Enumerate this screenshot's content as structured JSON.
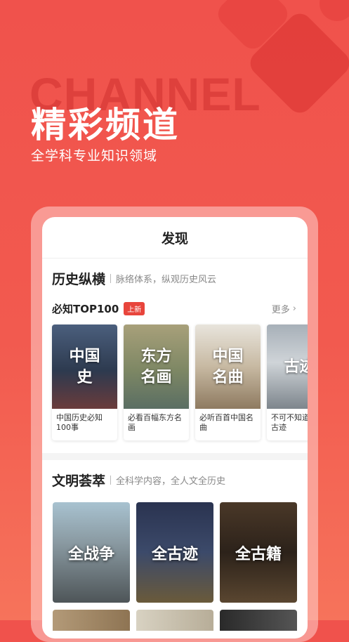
{
  "hero": {
    "background_word": "CHANNEL",
    "title": "精彩频道",
    "subtitle": "全学科专业知识领域"
  },
  "app": {
    "topbar_title": "发现",
    "section1": {
      "title": "历史纵横",
      "subtitle": "脉络体系，纵观历史风云",
      "list_title": "必知TOP100",
      "badge": "上新",
      "more": "更多",
      "cards": [
        {
          "image_text": "中国史",
          "caption": "中国历史必知100事"
        },
        {
          "image_text": "东方名画",
          "caption": "必看百幅东方名画"
        },
        {
          "image_text": "中国名曲",
          "caption": "必听百首中国名曲"
        },
        {
          "image_text": "古迹",
          "caption": "不可不知道百大古迹"
        }
      ]
    },
    "section2": {
      "title": "文明荟萃",
      "subtitle": "全科学内容，全人文全历史",
      "tiles": [
        {
          "label": "全战争"
        },
        {
          "label": "全古迹"
        },
        {
          "label": "全古籍"
        }
      ]
    }
  },
  "colors": {
    "background": "#f0524c",
    "accent_badge": "#e8453c",
    "card_bg": "#ffffff"
  }
}
